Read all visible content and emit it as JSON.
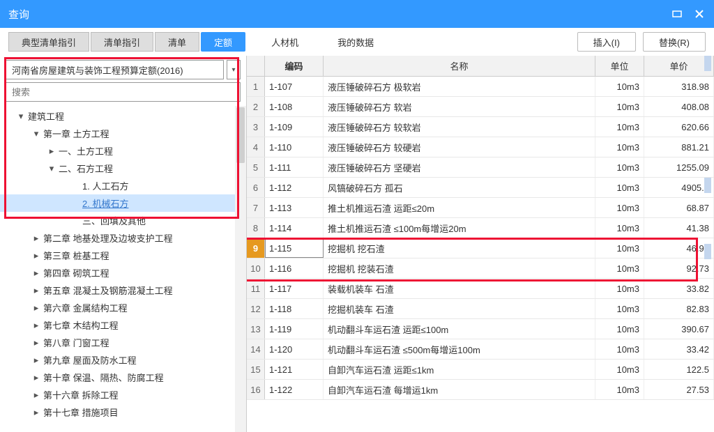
{
  "window": {
    "title": "查询"
  },
  "tabs": [
    "典型清单指引",
    "清单指引",
    "清单",
    "定额",
    "人材机",
    "我的数据"
  ],
  "tabs_active_index": 3,
  "actions": {
    "insert": "插入(I)",
    "replace": "替换(R)"
  },
  "dropdown": {
    "value": "河南省房屋建筑与装饰工程预算定额(2016)"
  },
  "search": {
    "placeholder": "搜索"
  },
  "tree": [
    {
      "indent": 22,
      "arrow": "▾",
      "label": "建筑工程"
    },
    {
      "indent": 44,
      "arrow": "▾",
      "label": "第一章 土方工程"
    },
    {
      "indent": 66,
      "arrow": "▸",
      "label": "一、土方工程"
    },
    {
      "indent": 66,
      "arrow": "▾",
      "label": "二、石方工程"
    },
    {
      "indent": 100,
      "arrow": "",
      "label": "1. 人工石方"
    },
    {
      "indent": 100,
      "arrow": "",
      "label": "2. 机械石方",
      "selected": true,
      "link": true
    },
    {
      "indent": 100,
      "arrow": "",
      "label": "三、回填及其他"
    },
    {
      "indent": 44,
      "arrow": "▸",
      "label": "第二章 地基处理及边坡支护工程"
    },
    {
      "indent": 44,
      "arrow": "▸",
      "label": "第三章 桩基工程"
    },
    {
      "indent": 44,
      "arrow": "▸",
      "label": "第四章 砌筑工程"
    },
    {
      "indent": 44,
      "arrow": "▸",
      "label": "第五章 混凝土及钢筋混凝土工程"
    },
    {
      "indent": 44,
      "arrow": "▸",
      "label": "第六章 金属结构工程"
    },
    {
      "indent": 44,
      "arrow": "▸",
      "label": "第七章 木结构工程"
    },
    {
      "indent": 44,
      "arrow": "▸",
      "label": "第八章 门窗工程"
    },
    {
      "indent": 44,
      "arrow": "▸",
      "label": "第九章 屋面及防水工程"
    },
    {
      "indent": 44,
      "arrow": "▸",
      "label": "第十章 保温、隔热、防腐工程"
    },
    {
      "indent": 44,
      "arrow": "▸",
      "label": "第十六章 拆除工程"
    },
    {
      "indent": 44,
      "arrow": "▸",
      "label": "第十七章 措施项目"
    }
  ],
  "grid": {
    "headers": {
      "code": "编码",
      "name": "名称",
      "unit": "单位",
      "price": "单价"
    },
    "rows": [
      {
        "n": "1",
        "code": "1-107",
        "name": "液压锤破碎石方 极软岩",
        "unit": "10m3",
        "price": "318.98"
      },
      {
        "n": "2",
        "code": "1-108",
        "name": "液压锤破碎石方 软岩",
        "unit": "10m3",
        "price": "408.08"
      },
      {
        "n": "3",
        "code": "1-109",
        "name": "液压锤破碎石方 较软岩",
        "unit": "10m3",
        "price": "620.66"
      },
      {
        "n": "4",
        "code": "1-110",
        "name": "液压锤破碎石方 较硬岩",
        "unit": "10m3",
        "price": "881.21"
      },
      {
        "n": "5",
        "code": "1-111",
        "name": "液压锤破碎石方 坚硬岩",
        "unit": "10m3",
        "price": "1255.09"
      },
      {
        "n": "6",
        "code": "1-112",
        "name": "风镐破碎石方 孤石",
        "unit": "10m3",
        "price": "4905.3"
      },
      {
        "n": "7",
        "code": "1-113",
        "name": "推土机推运石渣 运距≤20m",
        "unit": "10m3",
        "price": "68.87"
      },
      {
        "n": "8",
        "code": "1-114",
        "name": "推土机推运石渣 ≤100m每增运20m",
        "unit": "10m3",
        "price": "41.38"
      },
      {
        "n": "9",
        "code": "1-115",
        "name": "挖掘机 挖石渣",
        "unit": "10m3",
        "price": "46.99",
        "selected": true
      },
      {
        "n": "10",
        "code": "1-116",
        "name": "挖掘机 挖装石渣",
        "unit": "10m3",
        "price": "92.73"
      },
      {
        "n": "11",
        "code": "1-117",
        "name": "装载机装车 石渣",
        "unit": "10m3",
        "price": "33.82"
      },
      {
        "n": "12",
        "code": "1-118",
        "name": "挖掘机装车 石渣",
        "unit": "10m3",
        "price": "82.83"
      },
      {
        "n": "13",
        "code": "1-119",
        "name": "机动翻斗车运石渣 运距≤100m",
        "unit": "10m3",
        "price": "390.67"
      },
      {
        "n": "14",
        "code": "1-120",
        "name": "机动翻斗车运石渣 ≤500m每增运100m",
        "unit": "10m3",
        "price": "33.42"
      },
      {
        "n": "15",
        "code": "1-121",
        "name": "自卸汽车运石渣 运距≤1km",
        "unit": "10m3",
        "price": "122.5"
      },
      {
        "n": "16",
        "code": "1-122",
        "name": "自卸汽车运石渣 每增运1km",
        "unit": "10m3",
        "price": "27.53"
      }
    ]
  }
}
